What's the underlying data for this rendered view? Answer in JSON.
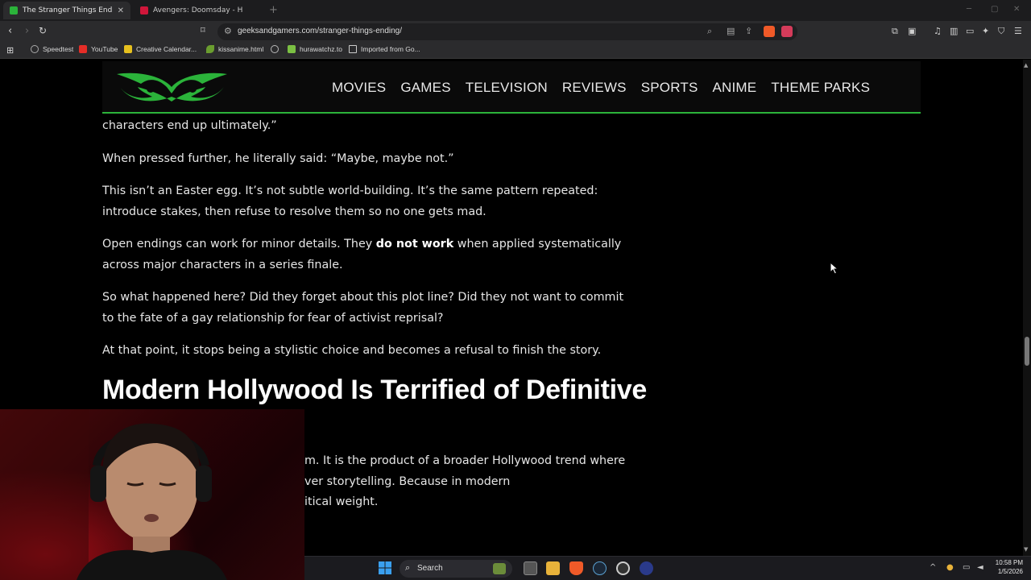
{
  "browser": {
    "tabs": [
      {
        "title": "The Stranger Things Ending Is the",
        "active": true,
        "favicon_color": "#2bb33a"
      },
      {
        "title": "Avengers: Doomsday - Have Marvel",
        "active": false,
        "favicon_color": "#d0163a"
      }
    ],
    "url": "geeksandgamers.com/stranger-things-ending/",
    "bookmarks": [
      {
        "label": "Speedtest",
        "icon": "speedtest-icon"
      },
      {
        "label": "YouTube",
        "icon": "youtube-icon"
      },
      {
        "label": "Creative Calendar...",
        "icon": "calendar-icon"
      },
      {
        "label": "kissanime.html",
        "icon": "leaf-icon"
      },
      {
        "label": "",
        "icon": "globe-icon"
      },
      {
        "label": "hurawatchz.to",
        "icon": "hurawatch-icon"
      },
      {
        "label": "Imported from Go...",
        "icon": "folder-icon"
      }
    ]
  },
  "site": {
    "nav": [
      "MOVIES",
      "GAMES",
      "TELEVISION",
      "REVIEWS",
      "SPORTS",
      "ANIME",
      "THEME PARKS"
    ],
    "accent": "#2bb33a"
  },
  "article": {
    "p0": "characters end up ultimately.”",
    "p1": "When pressed further, he literally said: “Maybe, maybe not.”",
    "p2": "This isn’t an Easter egg. It’s not subtle world-building. It’s the same pattern repeated: introduce stakes, then refuse to resolve them so no one gets mad.",
    "p3_before": "Open endings can work for minor details. They ",
    "p3_bold": "do not work",
    "p3_after": " when applied systematically across major characters in a series finale.",
    "p4": "So what happened here? Did they forget about this plot line? Did they not want to commit to the fate of a gay relationship for fear of activist reprisal?",
    "p5": "At that point, it stops being a stylistic choice and becomes a refusal to finish the story.",
    "heading": "Modern Hollywood Is Terrified of Definitive",
    "p6_line1": "m. It is the product of a broader Hollywood trend where",
    "p6_line2": "ver storytelling. Because in modern",
    "p6_line3": "itical weight."
  },
  "taskbar": {
    "search_label": "Search",
    "time": "10:58 PM",
    "date": "1/5/2026"
  }
}
